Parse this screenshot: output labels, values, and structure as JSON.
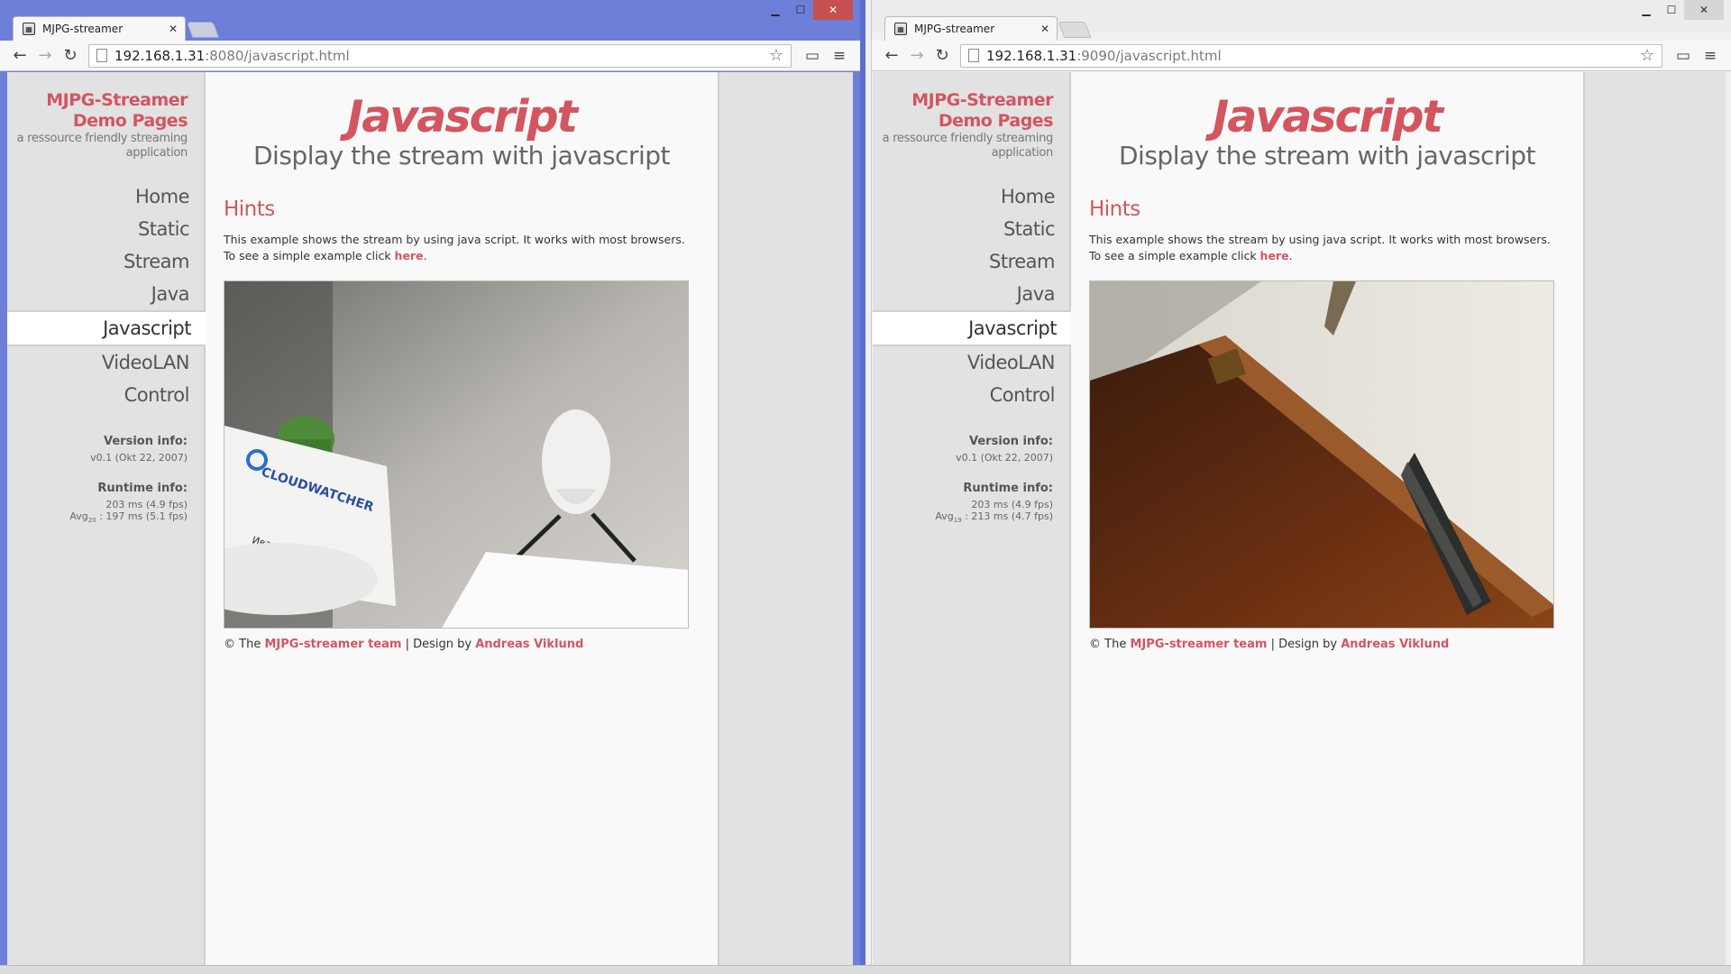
{
  "windows": [
    {
      "tab_title": "MJPG-streamer",
      "url_host": "192.168.1.31",
      "url_rest": ":8080/javascript.html",
      "logo_line1": "MJPG-Streamer",
      "logo_line2": "Demo Pages",
      "logo_sub1": "a ressource friendly streaming",
      "logo_sub2": "application",
      "menu": [
        "Home",
        "Static",
        "Stream",
        "Java",
        "Javascript",
        "VideoLAN",
        "Control"
      ],
      "active_menu": "Javascript",
      "version_head": "Version info:",
      "version_value": "v0.1 (Okt 22, 2007)",
      "runtime_head": "Runtime info:",
      "runtime_line1": "203 ms (4.9 fps)",
      "runtime_avg_label": "Avg",
      "runtime_avg_sub": "20",
      "runtime_avg_value": ": 197 ms (5.1 fps)",
      "title": "Javascript",
      "subtitle": "Display the stream with javascript",
      "hints_head": "Hints",
      "hint_line1": "This example shows the stream by using java script. It works with most browsers.",
      "hint_line2_prefix": "To see a simple example click ",
      "hint_link": "here",
      "hint_line2_suffix": ".",
      "footer_prefix": "© The ",
      "footer_link1": "MJPG-streamer team",
      "footer_mid": " | Design by ",
      "footer_link2": "Andreas Viklund",
      "stream_scene": "robot-figure-and-cloudwatcher-card"
    },
    {
      "tab_title": "MJPG-streamer",
      "url_host": "192.168.1.31",
      "url_rest": ":9090/javascript.html",
      "logo_line1": "MJPG-Streamer",
      "logo_line2": "Demo Pages",
      "logo_sub1": "a ressource friendly streaming",
      "logo_sub2": "application",
      "menu": [
        "Home",
        "Static",
        "Stream",
        "Java",
        "Javascript",
        "VideoLAN",
        "Control"
      ],
      "active_menu": "Javascript",
      "version_head": "Version info:",
      "version_value": "v0.1 (Okt 22, 2007)",
      "runtime_head": "Runtime info:",
      "runtime_line1": "203 ms (4.9 fps)",
      "runtime_avg_label": "Avg",
      "runtime_avg_sub": "19",
      "runtime_avg_value": ": 213 ms (4.7 fps)",
      "title": "Javascript",
      "subtitle": "Display the stream with javascript",
      "hints_head": "Hints",
      "hint_line1": "This example shows the stream by using java script. It works with most browsers.",
      "hint_line2_prefix": "To see a simple example click ",
      "hint_link": "here",
      "hint_line2_suffix": ".",
      "footer_prefix": "© The ",
      "footer_link1": "MJPG-streamer team",
      "footer_mid": " | Design by ",
      "footer_link2": "Andreas Viklund",
      "stream_scene": "wooden-shelf-and-wall"
    }
  ],
  "colors": {
    "accent": "#d35560",
    "active_titlebar": "#6d7fd8",
    "sidebar_bg": "#e2e2e2"
  }
}
